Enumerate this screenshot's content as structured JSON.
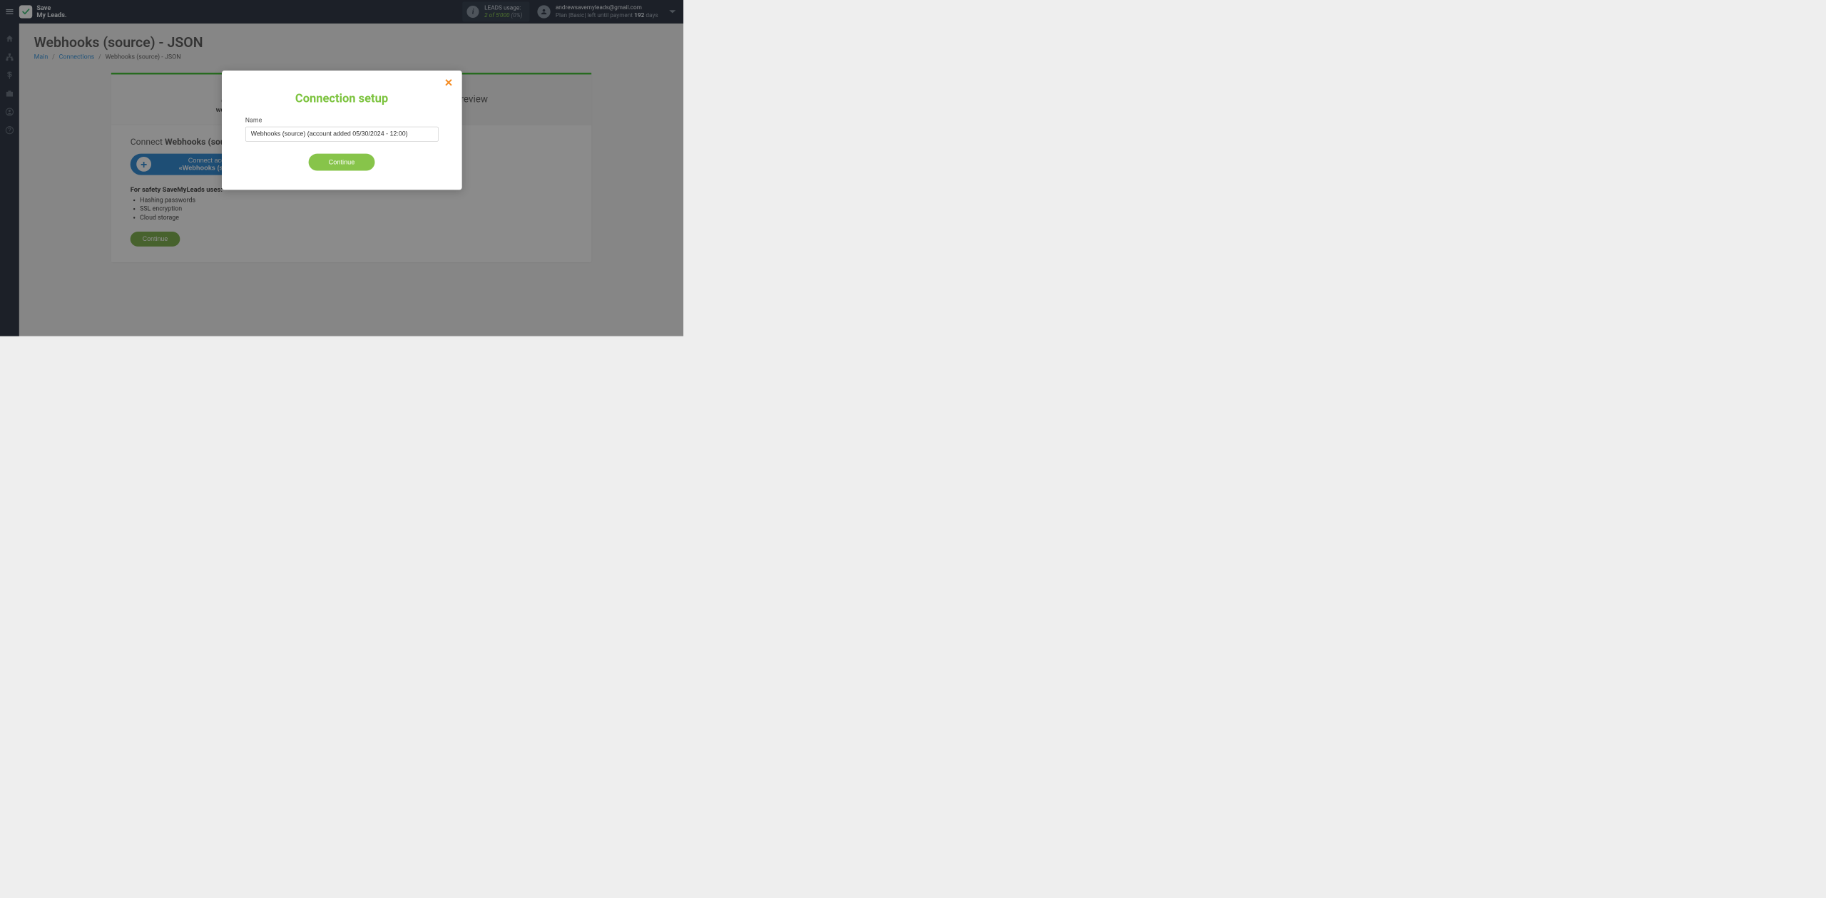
{
  "logo": {
    "line1": "Save",
    "line2": "My Leads."
  },
  "leads_usage": {
    "title": "LEADS usage:",
    "used": "2",
    "of": "of",
    "total": "5'000",
    "percent": "(0%)"
  },
  "user": {
    "email": "andrewsavemyleads@gmail.com",
    "plan_prefix": "Plan |Basic| left until payment ",
    "days_num": "192",
    "days_suffix": " days"
  },
  "page": {
    "title": "Webhooks (source) - JSON",
    "breadcrumb": {
      "main": "Main",
      "connections": "Connections",
      "current": "Webhooks (source) - JSON"
    }
  },
  "panel": {
    "tab_left_logo_text": "webhooks",
    "tab_right": "Preview",
    "connect_prefix": "Connect ",
    "connect_bold": "Webhooks (source)",
    "connect_account_line1": "Connect account",
    "connect_account_line2": "«Webhooks (source)»",
    "safety_title": "For safety SaveMyLeads uses:",
    "safety_items": [
      "Hashing passwords",
      "SSL encryption",
      "Cloud storage"
    ],
    "continue": "Continue"
  },
  "modal": {
    "title": "Connection setup",
    "label": "Name",
    "input_value": "Webhooks (source) (account added 05/30/2024 - 12:00)",
    "continue": "Continue"
  }
}
